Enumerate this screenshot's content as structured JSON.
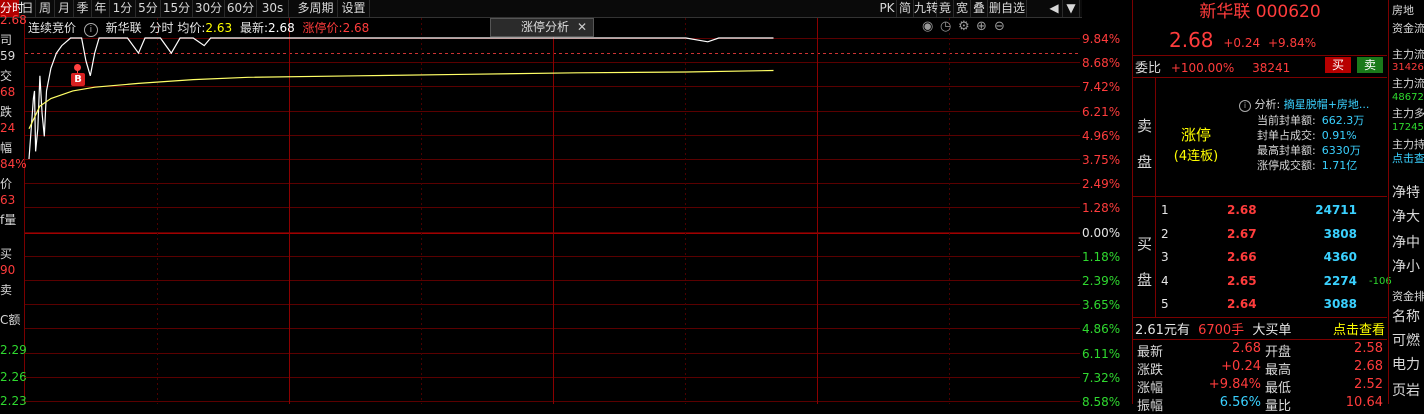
{
  "toolbar": {
    "items": [
      "分时",
      "日",
      "周",
      "月",
      "季",
      "年",
      "1分",
      "5分",
      "15分",
      "30分",
      "60分",
      "30s",
      "多周期",
      "设置"
    ],
    "active_index": 0,
    "right_items": [
      "PK",
      "简",
      "九转",
      "竟",
      "宽",
      "叠",
      "删自选"
    ]
  },
  "left_strip": {
    "labels": [
      {
        "text": "2.68",
        "color": "#ff3c3c"
      },
      {
        "text": "司",
        "color": "#d8d8d8"
      },
      {
        "text": "59",
        "color": "#d8d8d8"
      },
      {
        "text": "交",
        "color": "#d8d8d8"
      },
      {
        "text": "68",
        "color": "#ff3c3c"
      },
      {
        "text": "跌",
        "color": "#d8d8d8"
      },
      {
        "text": "24",
        "color": "#ff3c3c"
      },
      {
        "text": "幅",
        "color": "#d8d8d8"
      },
      {
        "text": "84%",
        "color": "#ff3c3c"
      },
      {
        "text": "价",
        "color": "#d8d8d8"
      },
      {
        "text": "63",
        "color": "#ff3c3c"
      },
      {
        "text": "f量",
        "color": "#d8d8d8"
      },
      {
        "text": "买",
        "color": "#d8d8d8"
      },
      {
        "text": "90",
        "color": "#ff3c3c"
      },
      {
        "text": "卖",
        "color": "#d8d8d8"
      },
      {
        "text": "C额",
        "color": "#d8d8d8"
      },
      {
        "text": "2.29",
        "color": "#2fd92f"
      },
      {
        "text": "2.26",
        "color": "#2fd92f"
      },
      {
        "text": "2.23",
        "color": "#2fd92f"
      }
    ]
  },
  "chart_header": {
    "auction": "连续竞价",
    "name": "新华联",
    "mode": "分时",
    "avg_label": "均价:",
    "avg_value": "2.63",
    "last_label": "最新:",
    "last_value": "2.68",
    "limit_label": "涨停价:",
    "limit_value": "2.68"
  },
  "popup": {
    "title": "涨停分析",
    "close": "✕"
  },
  "marker": {
    "label": "B"
  },
  "chart_data": {
    "type": "line",
    "title": "",
    "ylim_pct": [
      -9.84,
      9.84
    ],
    "ylim_price": [
      2.2,
      2.68
    ],
    "right_axis_labels": [
      {
        "text": "9.84%",
        "color": "#ff3c3c"
      },
      {
        "text": "8.68%",
        "color": "#ff3c3c"
      },
      {
        "text": "7.42%",
        "color": "#ff3c3c"
      },
      {
        "text": "6.21%",
        "color": "#ff3c3c"
      },
      {
        "text": "4.96%",
        "color": "#ff3c3c"
      },
      {
        "text": "3.75%",
        "color": "#ff3c3c"
      },
      {
        "text": "2.49%",
        "color": "#ff3c3c"
      },
      {
        "text": "1.28%",
        "color": "#ff3c3c"
      },
      {
        "text": "0.00%",
        "color": "#e6e6e6"
      },
      {
        "text": "1.18%",
        "color": "#2fd92f"
      },
      {
        "text": "2.39%",
        "color": "#2fd92f"
      },
      {
        "text": "3.65%",
        "color": "#2fd92f"
      },
      {
        "text": "4.86%",
        "color": "#2fd92f"
      },
      {
        "text": "6.11%",
        "color": "#2fd92f"
      },
      {
        "text": "7.32%",
        "color": "#2fd92f"
      },
      {
        "text": "8.58%",
        "color": "#2fd92f"
      }
    ],
    "series": [
      {
        "color": "#ffffff",
        "points": [
          [
            0,
            2.52
          ],
          [
            2,
            2.56
          ],
          [
            4,
            2.6
          ],
          [
            5,
            2.61
          ],
          [
            6,
            2.53
          ],
          [
            8,
            2.56
          ],
          [
            10,
            2.63
          ],
          [
            12,
            2.58
          ],
          [
            14,
            2.55
          ],
          [
            16,
            2.61
          ],
          [
            20,
            2.64
          ],
          [
            25,
            2.66
          ],
          [
            30,
            2.67
          ],
          [
            38,
            2.68
          ],
          [
            48,
            2.68
          ],
          [
            52,
            2.65
          ],
          [
            56,
            2.63
          ],
          [
            60,
            2.66
          ],
          [
            64,
            2.68
          ],
          [
            80,
            2.68
          ],
          [
            90,
            2.68
          ],
          [
            100,
            2.66
          ],
          [
            106,
            2.68
          ],
          [
            120,
            2.68
          ],
          [
            130,
            2.66
          ],
          [
            134,
            2.67
          ],
          [
            138,
            2.68
          ],
          [
            150,
            2.68
          ],
          [
            160,
            2.67
          ],
          [
            166,
            2.68
          ],
          [
            180,
            2.68
          ],
          [
            600,
            2.68
          ],
          [
            620,
            2.675
          ],
          [
            630,
            2.68
          ],
          [
            680,
            2.68
          ]
        ]
      },
      {
        "color": "#ffff66",
        "points": [
          [
            0,
            2.56
          ],
          [
            10,
            2.59
          ],
          [
            20,
            2.6
          ],
          [
            40,
            2.61
          ],
          [
            60,
            2.615
          ],
          [
            100,
            2.62
          ],
          [
            150,
            2.625
          ],
          [
            200,
            2.628
          ],
          [
            300,
            2.63
          ],
          [
            400,
            2.632
          ],
          [
            500,
            2.634
          ],
          [
            600,
            2.635
          ],
          [
            680,
            2.637
          ]
        ]
      }
    ],
    "x_max": 960
  },
  "quote": {
    "name": "新华联",
    "code": "000620",
    "price": "2.68",
    "change": "+0.24",
    "change_pct": "+9.84%",
    "weibi_label": "委比",
    "weibi_value": "+100.00%",
    "weicha_value": "38241",
    "buy_btn": "买",
    "sell_btn": "卖"
  },
  "sell_panel": {
    "side_label_1": "卖",
    "side_label_2": "盘",
    "limit_title": "涨停",
    "limit_sub": "(4连板)",
    "analysis_label": "分析:",
    "analysis_value": "摘星脱帽+房地...",
    "rows": [
      {
        "label": "当前封单额:",
        "value": "662.3万"
      },
      {
        "label": "封单占成交:",
        "value": "0.91%"
      },
      {
        "label": "最高封单额:",
        "value": "6330万"
      },
      {
        "label": "涨停成交额:",
        "value": "1.71亿"
      }
    ]
  },
  "buy_panel": {
    "side_label_1": "买",
    "side_label_2": "盘",
    "rows": [
      {
        "level": "1",
        "price": "2.68",
        "vol": "24711",
        "extra": ""
      },
      {
        "level": "2",
        "price": "2.67",
        "vol": "3808",
        "extra": ""
      },
      {
        "level": "3",
        "price": "2.66",
        "vol": "4360",
        "extra": ""
      },
      {
        "level": "4",
        "price": "2.65",
        "vol": "2274",
        "extra": "-106"
      },
      {
        "level": "5",
        "price": "2.64",
        "vol": "3088",
        "extra": ""
      }
    ]
  },
  "big_order": {
    "price": "2.61元有",
    "qty": "6700手",
    "label": "大买单",
    "link": "点击查看"
  },
  "stats": [
    {
      "l1": "最新",
      "v1": "2.68",
      "c1": "#ff3c3c",
      "l2": "开盘",
      "v2": "2.58",
      "c2": "#ff3c3c"
    },
    {
      "l1": "涨跌",
      "v1": "+0.24",
      "c1": "#ff3c3c",
      "l2": "最高",
      "v2": "2.68",
      "c2": "#ff3c3c"
    },
    {
      "l1": "涨幅",
      "v1": "+9.84%",
      "c1": "#ff3c3c",
      "l2": "最低",
      "v2": "2.52",
      "c2": "#ff3c3c"
    },
    {
      "l1": "振幅",
      "v1": "6.56%",
      "c1": "#3ad1ff",
      "l2": "量比",
      "v2": "10.64",
      "c2": "#ff3c3c"
    }
  ],
  "far_right": {
    "items": [
      {
        "text": "房地",
        "color": "#d8d8d8"
      },
      {
        "text": "资金流",
        "color": "#d8d8d8"
      },
      {
        "text": "主力流",
        "color": "#d8d8d8"
      },
      {
        "text": "31426",
        "color": "#ff3c3c"
      },
      {
        "text": "主力流",
        "color": "#d8d8d8"
      },
      {
        "text": "48672",
        "color": "#2fd92f"
      },
      {
        "text": "主力多",
        "color": "#d8d8d8"
      },
      {
        "text": "17245",
        "color": "#2fd92f"
      },
      {
        "text": "主力持",
        "color": "#d8d8d8"
      },
      {
        "text": "点击查",
        "color": "#3ad1ff"
      },
      {
        "text": "净特",
        "color": "#d8d8d8"
      },
      {
        "text": "净大",
        "color": "#d8d8d8"
      },
      {
        "text": "净中",
        "color": "#d8d8d8"
      },
      {
        "text": "净小",
        "color": "#d8d8d8"
      },
      {
        "text": "资金排",
        "color": "#d8d8d8"
      },
      {
        "text": "名称",
        "color": "#d8d8d8"
      },
      {
        "text": "可燃",
        "color": "#d8d8d8"
      },
      {
        "text": "电力",
        "color": "#d8d8d8"
      },
      {
        "text": "页岩",
        "color": "#d8d8d8"
      }
    ]
  }
}
